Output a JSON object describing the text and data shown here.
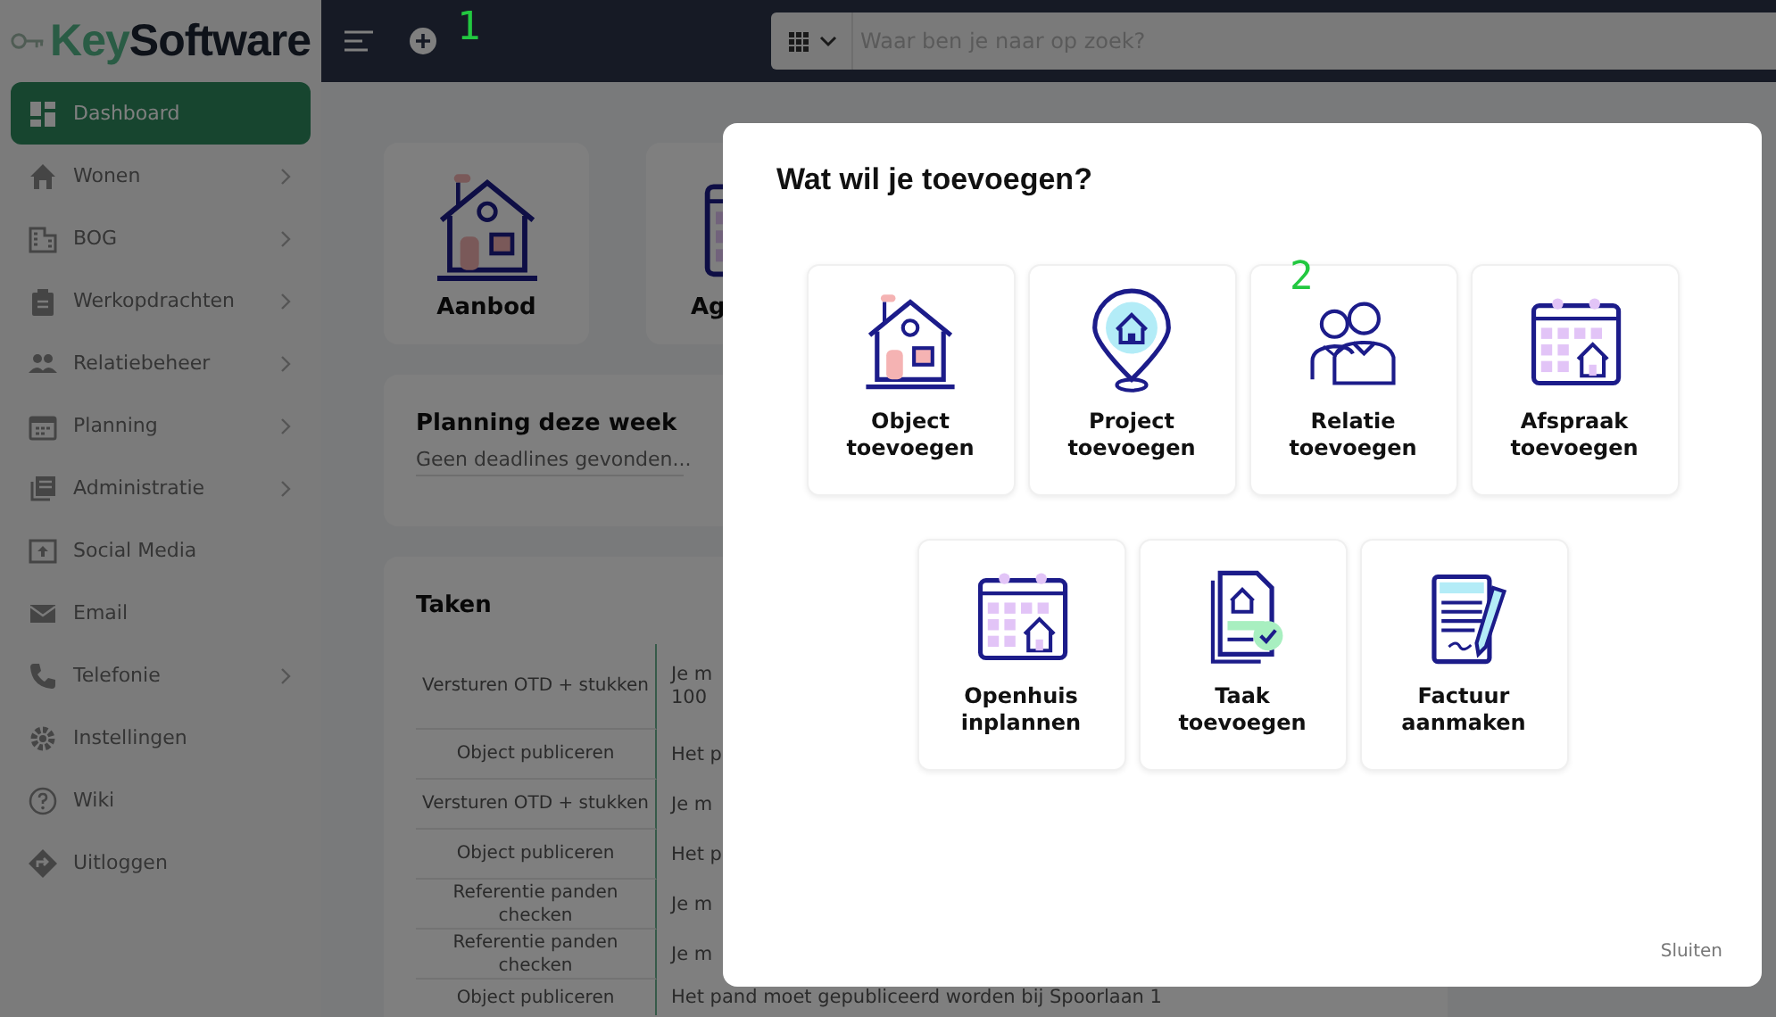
{
  "logo": {
    "part_1": "Key",
    "part_2": "Software"
  },
  "header": {
    "marker": "1",
    "search": {
      "placeholder": "Waar ben je naar op zoek?"
    }
  },
  "sidebar": {
    "items": [
      {
        "label": "Dashboard",
        "selected": true,
        "submenu": false
      },
      {
        "label": "Wonen",
        "selected": false,
        "submenu": true
      },
      {
        "label": "BOG",
        "selected": false,
        "submenu": true
      },
      {
        "label": "Werkopdrachten",
        "selected": false,
        "submenu": true
      },
      {
        "label": "Relatiebeheer",
        "selected": false,
        "submenu": true
      },
      {
        "label": "Planning",
        "selected": false,
        "submenu": true
      },
      {
        "label": "Administratie",
        "selected": false,
        "submenu": true
      },
      {
        "label": "Social Media",
        "selected": false,
        "submenu": false
      },
      {
        "label": "Email",
        "selected": false,
        "submenu": false
      },
      {
        "label": "Telefonie",
        "selected": false,
        "submenu": true
      },
      {
        "label": "Instellingen",
        "selected": false,
        "submenu": false
      },
      {
        "label": "Wiki",
        "selected": false,
        "submenu": false
      },
      {
        "label": "Uitloggen",
        "selected": false,
        "submenu": false
      }
    ]
  },
  "shortcuts": [
    {
      "label": "Aanbod"
    },
    {
      "label": "Ag"
    }
  ],
  "planning": {
    "title": "Planning deze week",
    "empty_text": "Geen deadlines gevonden..."
  },
  "tasks": {
    "title": "Taken",
    "rows": [
      {
        "task": "Versturen OTD + stukken",
        "description": "Je m\n100"
      },
      {
        "task": "Object publiceren",
        "description": "Het p"
      },
      {
        "task": "Versturen OTD + stukken",
        "description": "Je m"
      },
      {
        "task": "Object publiceren",
        "description": "Het p"
      },
      {
        "task": "Referentie panden checken",
        "description": "Je m"
      },
      {
        "task": "Referentie panden checken",
        "description": "Je m"
      },
      {
        "task": "Object publiceren",
        "description": "Het pand moet gepubliceerd worden bij Spoorlaan 1"
      }
    ]
  },
  "dialog": {
    "title": "Wat wil je toevoegen?",
    "tiles": [
      {
        "label": "Object toevoegen"
      },
      {
        "label": "Project toevoegen"
      },
      {
        "label": "Relatie toevoegen",
        "marker": "2"
      },
      {
        "label": "Afspraak toevoegen"
      },
      {
        "label": "Openhuis inplannen"
      },
      {
        "label": "Taak toevoegen"
      },
      {
        "label": "Factuur aanmaken"
      }
    ],
    "close": "Sluiten"
  }
}
